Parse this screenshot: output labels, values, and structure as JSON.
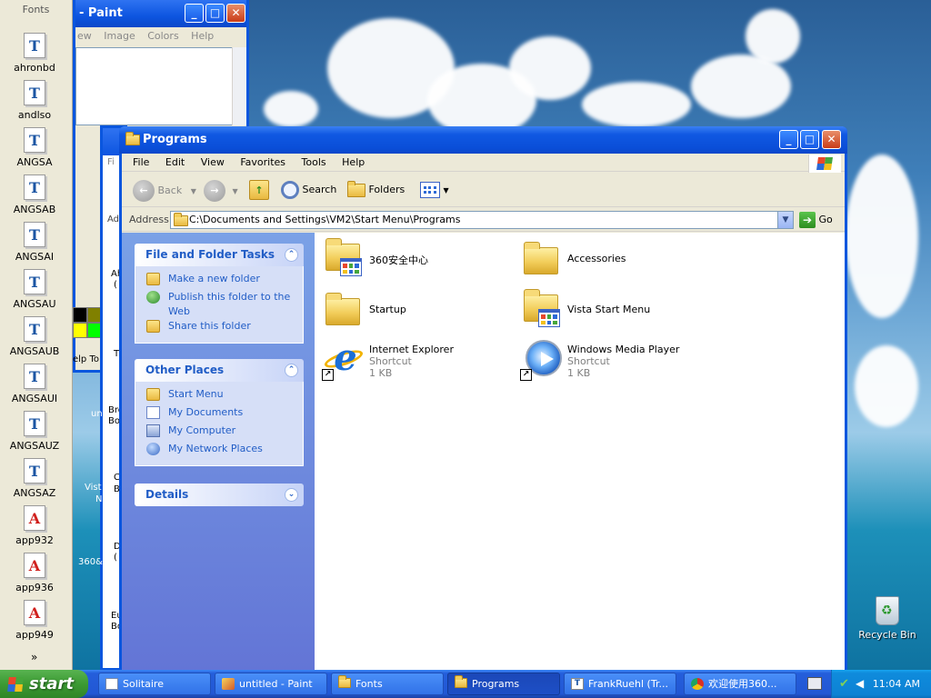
{
  "fonts_window": {
    "title": "Fonts",
    "items": [
      {
        "label": "ahronbd",
        "kind": "T"
      },
      {
        "label": "andlso",
        "kind": "T"
      },
      {
        "label": "ANGSA",
        "kind": "T"
      },
      {
        "label": "ANGSAB",
        "kind": "T"
      },
      {
        "label": "ANGSAI",
        "kind": "T"
      },
      {
        "label": "ANGSAU",
        "kind": "T"
      },
      {
        "label": "ANGSAUB",
        "kind": "T"
      },
      {
        "label": "ANGSAUI",
        "kind": "T"
      },
      {
        "label": "ANGSAUZ",
        "kind": "T"
      },
      {
        "label": "ANGSAZ",
        "kind": "T"
      },
      {
        "label": "app932",
        "kind": "A"
      },
      {
        "label": "app936",
        "kind": "A"
      },
      {
        "label": "app949",
        "kind": "A"
      }
    ],
    "more": "»"
  },
  "paint_window": {
    "title": "- Paint",
    "menu": [
      "ew",
      "Image",
      "Colors",
      "Help"
    ],
    "partial_help": "elp To"
  },
  "programs_window": {
    "title": "Programs",
    "menu": [
      "File",
      "Edit",
      "View",
      "Favorites",
      "Tools",
      "Help"
    ],
    "toolbar": {
      "back": "Back",
      "search": "Search",
      "folders": "Folders"
    },
    "address": {
      "label": "Address",
      "path": "C:\\Documents and Settings\\VM2\\Start Menu\\Programs",
      "go": "Go"
    },
    "tasks": {
      "title": "File and Folder Tasks",
      "links": [
        "Make a new folder",
        "Publish this folder to the Web",
        "Share this folder"
      ]
    },
    "other_places": {
      "title": "Other Places",
      "links": [
        "Start Menu",
        "My Documents",
        "My Computer",
        "My Network Places"
      ]
    },
    "details": {
      "title": "Details"
    },
    "files": [
      {
        "name": "360安全中心",
        "type": "",
        "size": ""
      },
      {
        "name": "Accessories",
        "type": "",
        "size": ""
      },
      {
        "name": "Startup",
        "type": "",
        "size": ""
      },
      {
        "name": "Vista Start Menu",
        "type": "",
        "size": ""
      },
      {
        "name": "Internet Explorer",
        "type": "Shortcut",
        "size": "1 KB"
      },
      {
        "name": "Windows Media Player",
        "type": "Shortcut",
        "size": "1 KB"
      }
    ]
  },
  "background_fragments": {
    "ah": "Ah",
    "paren1": "(",
    "t": "T",
    "bro": "Bro",
    "bo1": "Bo",
    "un": "un",
    "c": "C",
    "b1": "B",
    "vist": "Vist",
    "n": "N",
    "d": "D",
    "paren2": "(",
    "s360": "360&",
    "eu": "Eu",
    "bo2": "Bo",
    "fi": "Fi",
    "ad": "Ad"
  },
  "desktop": {
    "recycle_bin": "Recycle Bin"
  },
  "taskbar": {
    "start": "start",
    "buttons": [
      {
        "label": "Solitaire",
        "icon": "cards-icon"
      },
      {
        "label": "untitled - Paint",
        "icon": "paint-icon"
      },
      {
        "label": "Fonts",
        "icon": "folder-icon"
      },
      {
        "label": "Programs",
        "icon": "folder-icon",
        "active": true
      },
      {
        "label": "FrankRuehl (Tr...",
        "icon": "font-icon"
      },
      {
        "label": "欢迎使用360...",
        "icon": "chrome-icon"
      }
    ],
    "clock": "11:04 AM"
  }
}
